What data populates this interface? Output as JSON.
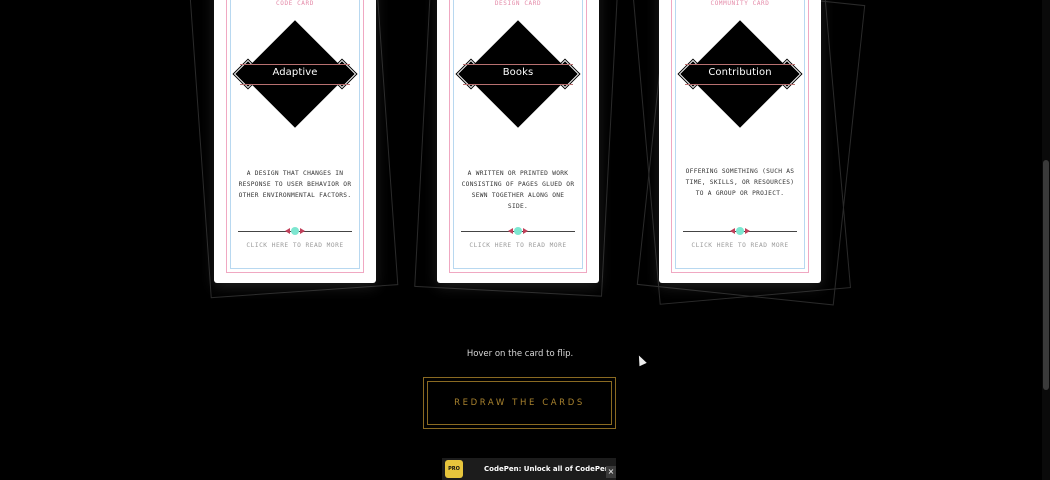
{
  "cards": [
    {
      "category": "CODE CARD",
      "title": "Adaptive",
      "description": "A DESIGN THAT CHANGES IN RESPONSE TO USER BEHAVIOR OR OTHER ENVIRONMENTAL FACTORS.",
      "read_more": "CLICK HERE TO READ MORE"
    },
    {
      "category": "DESIGN CARD",
      "title": "Books",
      "description": "A WRITTEN OR PRINTED WORK CONSISTING OF PAGES GLUED OR SEWN TOGETHER ALONG ONE SIDE.",
      "read_more": "CLICK HERE TO READ MORE"
    },
    {
      "category": "COMMUNITY CARD",
      "title": "Contribution",
      "description": "OFFERING SOMETHING (SUCH AS TIME, SKILLS, OR RESOURCES) TO A GROUP OR PROJECT.",
      "read_more": "CLICK HERE TO READ MORE"
    }
  ],
  "hint": "Hover on the card to flip.",
  "redraw_button": "REDRAW THE CARDS",
  "promo": {
    "badge": "PRO",
    "text": "CodePen: Unlock all of CodePen",
    "close": "×"
  },
  "colors": {
    "background": "#000000",
    "card": "#ffffff",
    "accent_gold": "#a8822e",
    "accent_pink": "#e48aa8",
    "accent_teal": "#7de6d0"
  }
}
